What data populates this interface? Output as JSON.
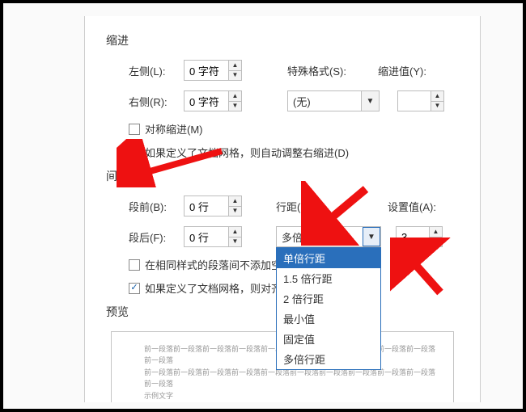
{
  "indent": {
    "title": "缩进",
    "leftLabel": "左侧(L):",
    "leftValue": "0 字符",
    "rightLabel": "右侧(R):",
    "rightValue": "0 字符",
    "specialLabel": "特殊格式(S):",
    "specialValue": "(无)",
    "indentValLabel": "缩进值(Y):",
    "indentVal": "",
    "mirror": "对称缩进(M)",
    "autoAdjust": "如果定义了文档网格，则自动调整右缩进(D)"
  },
  "spacing": {
    "title": "间距",
    "beforeLabel": "段前(B):",
    "beforeValue": "0 行",
    "afterLabel": "段后(F):",
    "afterValue": "0 行",
    "lineSpacingLabel": "行距(N):",
    "lineSpacingValue": "多倍行距",
    "setValueLabel": "设置值(A):",
    "setValue": "3",
    "noSpaceSame": "在相同样式的段落间不添加空格",
    "snapGrid": "如果定义了文档网格，则对齐到网格",
    "options": {
      "o1": "单倍行距",
      "o2": "1.5 倍行距",
      "o3": "2 倍行距",
      "o4": "最小值",
      "o5": "固定值",
      "o6": "多倍行距"
    }
  },
  "preview": {
    "title": "预览",
    "line1": "前一段落前一段落前一段落前一段落前一段落前一段落前一段落前一段落前一段落前一段落前一段落",
    "line2": "前一段落前一段落前一段落前一段落前一段落前一段落前一段落前一段落前一段落前一段落前一段落",
    "line3": "示例文字"
  }
}
